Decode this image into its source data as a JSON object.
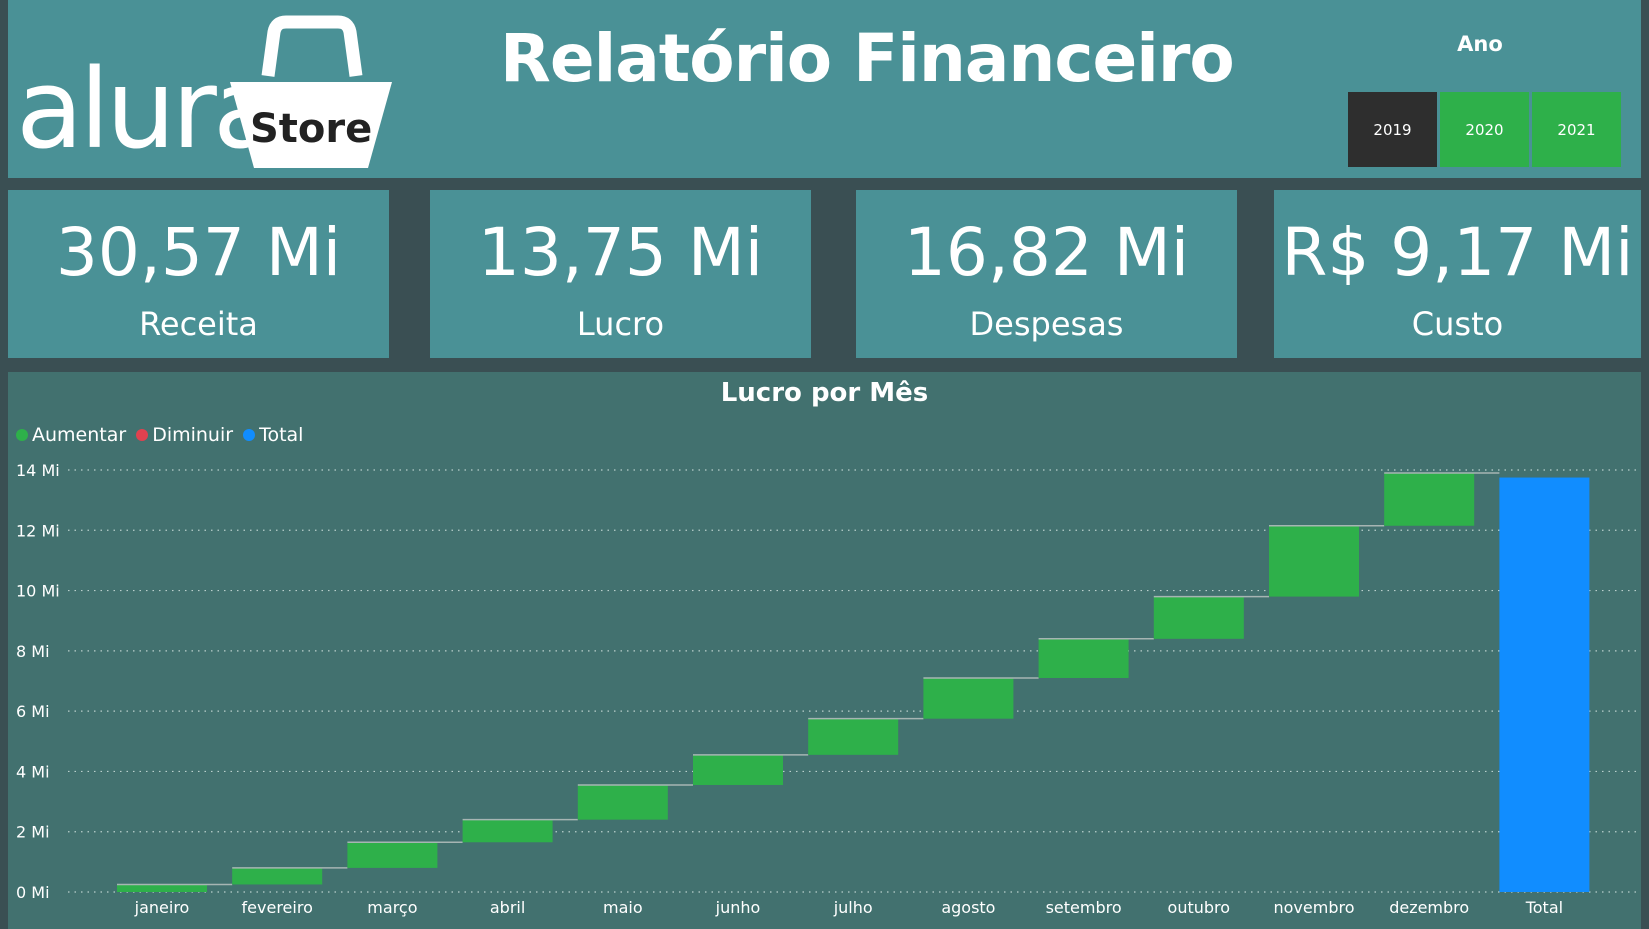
{
  "header": {
    "logo_text": "alura",
    "logo_badge": "Store",
    "title": "Relatório Financeiro",
    "slicer": {
      "label": "Ano",
      "years": [
        {
          "label": "2019",
          "selected": true
        },
        {
          "label": "2020",
          "selected": false
        },
        {
          "label": "2021",
          "selected": false
        }
      ]
    }
  },
  "kpis": [
    {
      "value": "30,57 Mi",
      "label": "Receita"
    },
    {
      "value": "13,75 Mi",
      "label": "Lucro"
    },
    {
      "value": "16,82 Mi",
      "label": "Despesas"
    },
    {
      "value": "R$ 9,17 Mi",
      "label": "Custo"
    }
  ],
  "colors": {
    "header_bg": "#4a9196",
    "page_bg": "#3a4f53",
    "chart_bg": "#42716f",
    "increase": "#2eb04a",
    "decrease": "#e0414f",
    "total": "#118dff",
    "selected_year": "#2e2e2e"
  },
  "chart_data": {
    "type": "waterfall",
    "title": "Lucro por Mês",
    "legend": [
      {
        "label": "Aumentar",
        "color": "#2eb04a"
      },
      {
        "label": "Diminuir",
        "color": "#e0414f"
      },
      {
        "label": "Total",
        "color": "#118dff"
      }
    ],
    "legend_position": "top-left",
    "categories": [
      "janeiro",
      "fevereiro",
      "março",
      "abril",
      "maio",
      "junho",
      "julho",
      "agosto",
      "setembro",
      "outubro",
      "novembro",
      "dezembro",
      "Total"
    ],
    "values": [
      0.25,
      0.55,
      0.85,
      0.75,
      1.15,
      1.0,
      1.2,
      1.35,
      1.3,
      1.4,
      2.35,
      1.75
    ],
    "total": 13.75,
    "unit": "Mi",
    "ylim": [
      0,
      14
    ],
    "yticks": [
      "0 Mi",
      "2 Mi",
      "4 Mi",
      "6 Mi",
      "8 Mi",
      "10 Mi",
      "12 Mi",
      "14 Mi"
    ],
    "grid": true
  }
}
